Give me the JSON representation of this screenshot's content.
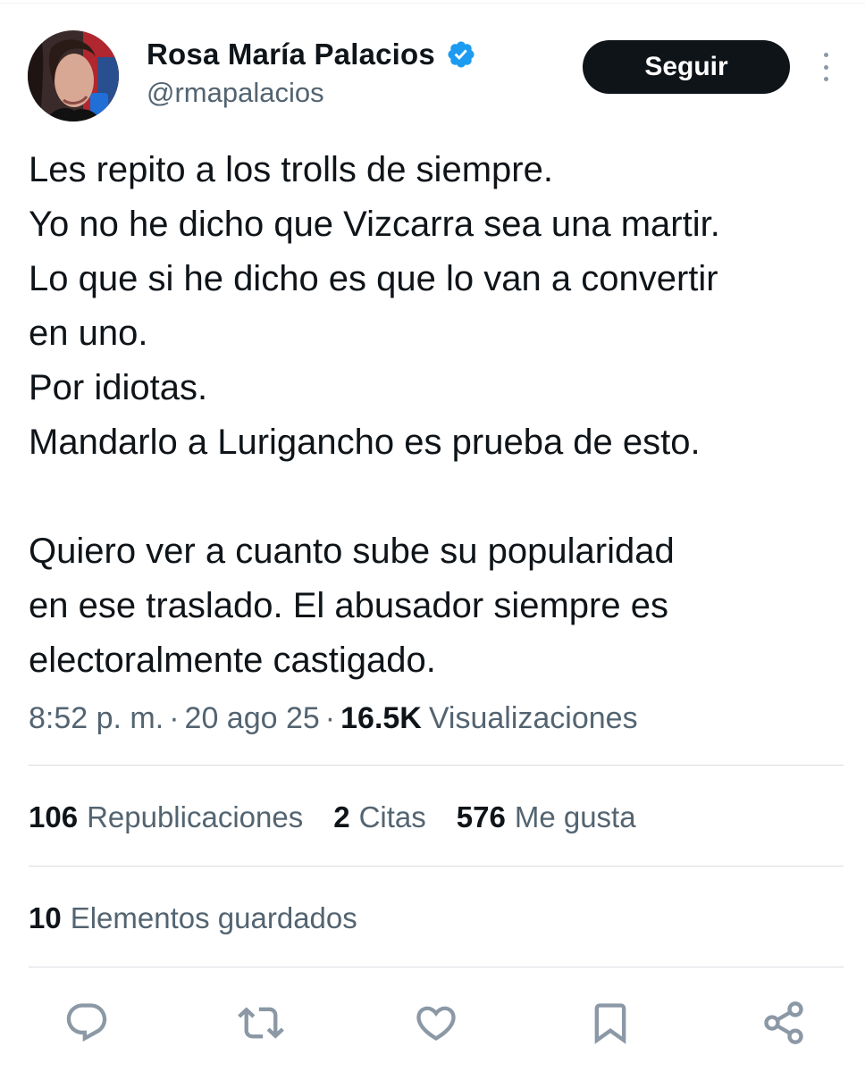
{
  "author": {
    "display_name": "Rosa María Palacios",
    "handle": "@rmapalacios",
    "verified": true
  },
  "header": {
    "follow_label": "Seguir"
  },
  "tweet": {
    "lines": [
      "Les repito a los trolls de siempre.",
      "Yo no he dicho que Vizcarra sea una martir.",
      "Lo que si he dicho es que lo van a convertir",
      "en uno.",
      "Por idiotas.",
      "Mandarlo a Lurigancho es prueba de esto.",
      "",
      "Quiero ver a cuanto sube su popularidad",
      "en ese traslado. El abusador siempre es",
      "electoralmente castigado."
    ]
  },
  "meta": {
    "time": "8:52 p. m.",
    "separator": "·",
    "date": "20 ago 25",
    "views_count": "16.5K",
    "views_label": "Visualizaciones"
  },
  "stats": {
    "reposts": {
      "count": "106",
      "label": "Republicaciones"
    },
    "quotes": {
      "count": "2",
      "label": "Citas"
    },
    "likes": {
      "count": "576",
      "label": "Me gusta"
    },
    "bookmarks": {
      "count": "10",
      "label": "Elementos guardados"
    }
  },
  "icons": {
    "reply": "reply-icon",
    "retweet": "retweet-icon",
    "like": "heart-icon",
    "bookmark": "bookmark-icon",
    "share": "share-icon",
    "more": "more-vertical-icon",
    "verified": "verified-badge-icon"
  },
  "colors": {
    "primary_text": "#0f1419",
    "secondary_text": "#536471",
    "verified_blue": "#1d9bf0",
    "divider": "#d9dee2",
    "action_icon": "#8b98a5",
    "follow_button_bg": "#0f1419",
    "follow_button_text": "#ffffff"
  }
}
